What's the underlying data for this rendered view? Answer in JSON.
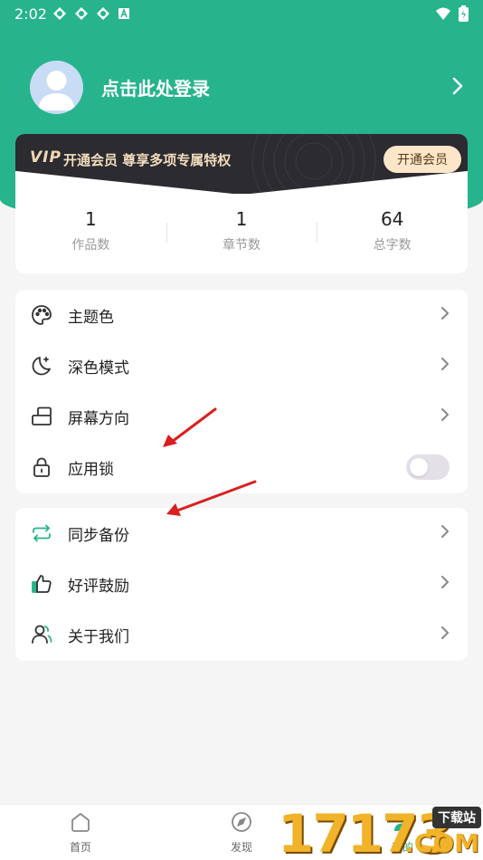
{
  "status_bar": {
    "time": "2:02"
  },
  "profile": {
    "login_text": "点击此处登录"
  },
  "vip": {
    "logo": "VIP",
    "promo": "开通会员 尊享多项专属特权",
    "button": "开通会员"
  },
  "stats": [
    {
      "value": "1",
      "label": "作品数"
    },
    {
      "value": "1",
      "label": "章节数"
    },
    {
      "value": "64",
      "label": "总字数"
    }
  ],
  "menu_group_1": [
    {
      "label": "主题色",
      "icon": "palette-icon"
    },
    {
      "label": "深色模式",
      "icon": "moon-icon"
    },
    {
      "label": "屏幕方向",
      "icon": "screen-rotate-icon"
    },
    {
      "label": "应用锁",
      "icon": "lock-icon",
      "toggle_on": false
    }
  ],
  "menu_group_2": [
    {
      "label": "同步备份",
      "icon": "sync-icon"
    },
    {
      "label": "好评鼓励",
      "icon": "thumbs-up-icon"
    },
    {
      "label": "关于我们",
      "icon": "people-icon"
    }
  ],
  "bottom_nav": [
    {
      "label": "首页",
      "icon": "home-icon"
    },
    {
      "label": "发现",
      "icon": "compass-icon"
    },
    {
      "label": "我的",
      "icon": "person-icon",
      "active": true
    }
  ],
  "watermark": {
    "digits": "17173",
    "tag": "下载站",
    "suffix": ".COM"
  },
  "colors": {
    "accent": "#27b48c",
    "vip_dark": "#2b2b30",
    "vip_gold": "#f3ddbe",
    "arrow_red": "#d9201f"
  }
}
